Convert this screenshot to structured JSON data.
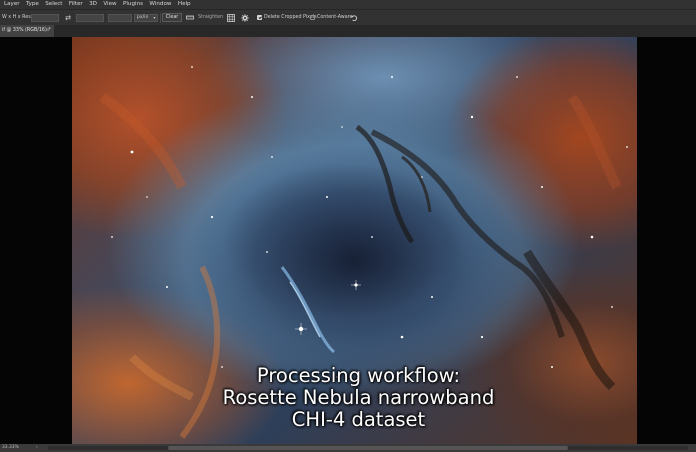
{
  "menu": {
    "items": [
      "Layer",
      "Type",
      "Select",
      "Filter",
      "3D",
      "View",
      "Plugins",
      "Window",
      "Help"
    ]
  },
  "options": {
    "ratio_label": "W x H x Reso...",
    "units_label": "px/in",
    "clear_label": "Clear",
    "straighten_label": "Straighten",
    "delete_cropped_label": "Delete Cropped Pixels",
    "delete_cropped_checked": true,
    "content_aware_label": "Content-Aware",
    "content_aware_checked": false
  },
  "document": {
    "tab_title": "if @ 33% (RGB/16) *",
    "tab_close": "×"
  },
  "caption": {
    "line1": "Processing workflow:",
    "line2": "Rosette Nebula narrowband",
    "line3": "CHI-4 dataset"
  },
  "status": {
    "zoom_text": "33.33%"
  }
}
